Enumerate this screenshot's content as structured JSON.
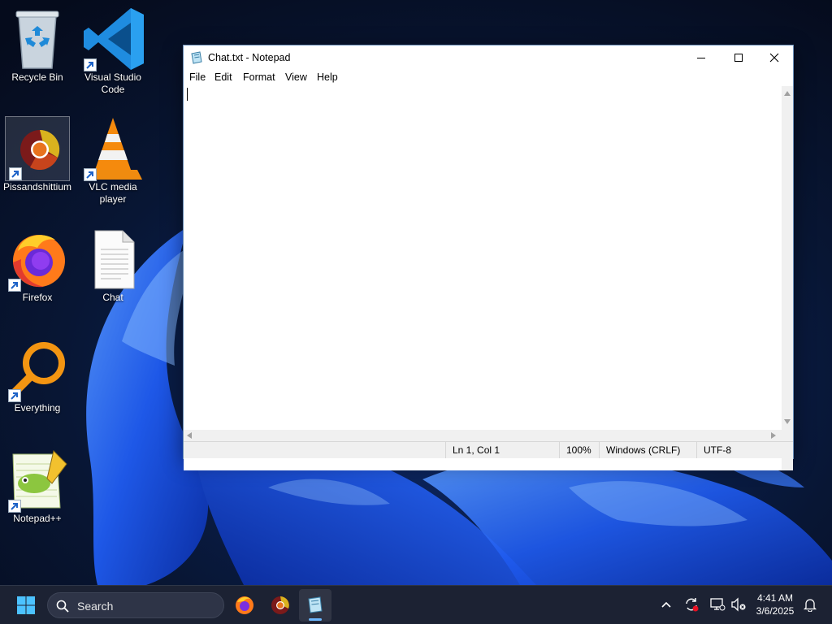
{
  "desktop": {
    "icons": [
      {
        "label": "Recycle Bin",
        "icon": "recycle-bin-icon"
      },
      {
        "label": "Visual Studio Code",
        "icon": "vscode-icon"
      },
      {
        "label": "Pissandshittium",
        "icon": "chromium-browser-icon"
      },
      {
        "label": "VLC media player",
        "icon": "vlc-icon"
      },
      {
        "label": "Firefox",
        "icon": "firefox-icon"
      },
      {
        "label": "Chat",
        "icon": "text-file-icon"
      },
      {
        "label": "Everything",
        "icon": "everything-search-icon"
      },
      {
        "label": "Notepad++",
        "icon": "notepad-plus-plus-icon"
      }
    ]
  },
  "notepad": {
    "title": "Chat.txt - Notepad",
    "menu": [
      "File",
      "Edit",
      "Format",
      "View",
      "Help"
    ],
    "content": "",
    "status": {
      "position": "Ln 1, Col 1",
      "zoom": "100%",
      "line_ending": "Windows (CRLF)",
      "encoding": "UTF-8"
    }
  },
  "taskbar": {
    "search_placeholder": "Search",
    "pinned": [
      {
        "name": "start-button",
        "icon": "windows-logo-icon"
      },
      {
        "name": "firefox",
        "icon": "firefox-icon"
      },
      {
        "name": "chromium",
        "icon": "chromium-browser-icon"
      },
      {
        "name": "notepad",
        "icon": "notepad-icon",
        "active": true
      }
    ],
    "clock": {
      "time": "4:41 AM",
      "date": "3/6/2025"
    }
  },
  "colors": {
    "accent": "#6bb7ff",
    "taskbar_bg": "#1c2233",
    "wallpaper_blue": "#1a56e8"
  }
}
